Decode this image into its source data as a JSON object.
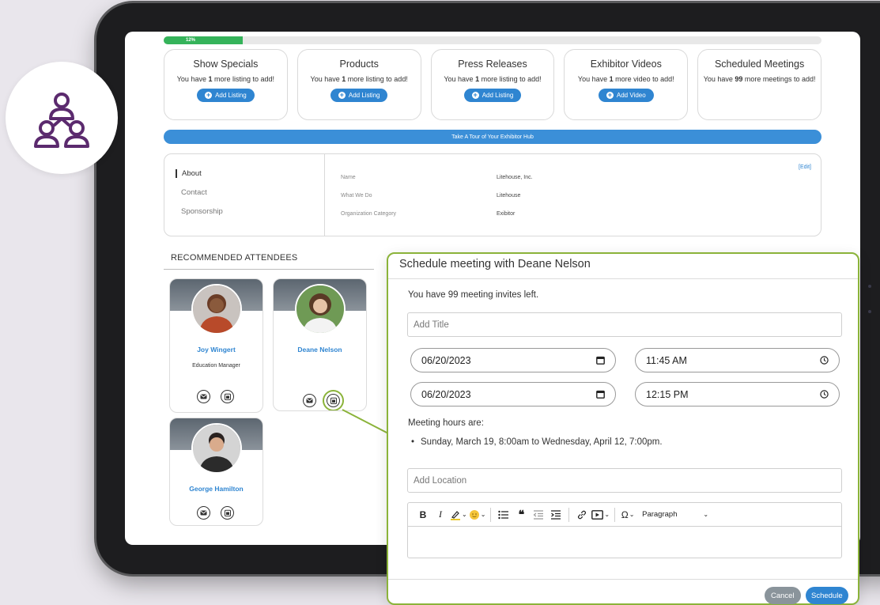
{
  "progress": {
    "label": "12%",
    "value": 12
  },
  "cards": [
    {
      "title": "Show Specials",
      "text_pre": "You have ",
      "count": "1",
      "text_post": " more listing to add!",
      "button": "Add Listing"
    },
    {
      "title": "Products",
      "text_pre": "You have ",
      "count": "1",
      "text_post": " more listing to add!",
      "button": "Add Listing"
    },
    {
      "title": "Press Releases",
      "text_pre": "You have ",
      "count": "1",
      "text_post": " more listing to add!",
      "button": "Add Listing"
    },
    {
      "title": "Exhibitor Videos",
      "text_pre": "You have ",
      "count": "1",
      "text_post": " more video to add!",
      "button": "Add Video"
    },
    {
      "title": "Scheduled Meetings",
      "text_pre": "You have ",
      "count": "99",
      "text_post": " more meetings to add!",
      "button": ""
    }
  ],
  "tour_bar": "Take A Tour of Your Exhibitor Hub",
  "about": {
    "nav": [
      "About",
      "Contact",
      "Sponsorship"
    ],
    "edit": "[Edit]",
    "rows": [
      {
        "key": "Name",
        "value": "Litehouse, Inc."
      },
      {
        "key": "What We Do",
        "value": "Litehouse"
      },
      {
        "key": "Organization Category",
        "value": "Exibitor"
      }
    ]
  },
  "attendees": {
    "heading": "RECOMMENDED ATTENDEES",
    "people": [
      {
        "name": "Joy Wingert",
        "role": "Education Manager"
      },
      {
        "name": "Deane Nelson",
        "role": ""
      },
      {
        "name": "George Hamilton",
        "role": ""
      }
    ]
  },
  "modal": {
    "title": "Schedule meeting with Deane Nelson",
    "invites": "You have 99 meeting invites left.",
    "title_placeholder": "Add Title",
    "start_date": "06/20/2023",
    "start_time": "11:45 AM",
    "end_date": "06/20/2023",
    "end_time": "12:15 PM",
    "hours_label": "Meeting hours are:",
    "hours_item": "Sunday, March 19, 8:00am to Wednesday, April 12, 7:00pm.",
    "location_placeholder": "Add Location",
    "paragraph": "Paragraph",
    "cancel": "Cancel",
    "schedule": "Schedule"
  },
  "colors": {
    "accent": "#2f85d1",
    "highlight": "#8bb33a",
    "progress": "#35b35a",
    "logo": "#5b2a6e"
  }
}
